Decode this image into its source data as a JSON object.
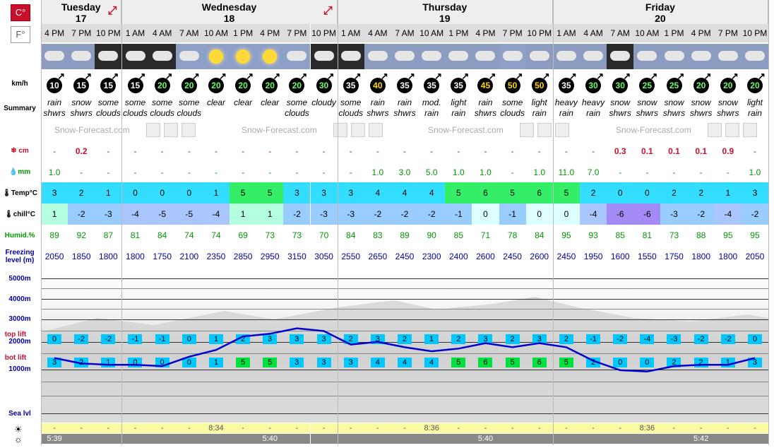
{
  "units": {
    "celsius": "C°",
    "fahrenheit": "F°"
  },
  "labels": {
    "wind": "km/h",
    "summary": "Summary",
    "snow": "cm",
    "rain": "mm",
    "temp": "Temp°C",
    "chill": "chill°C",
    "humidity": "Humid.%",
    "freezing": "Freezing level (m)",
    "alt5000": "5000m",
    "alt4000": "4000m",
    "alt3000": "3000m",
    "alt2000": "2000m",
    "alt1000": "1000m",
    "sea": "Sea lvl",
    "top_lift": "top lift",
    "bot_lift": "bot lift",
    "watermark": "Snow-Forecast.com"
  },
  "days": [
    {
      "name": "Tuesday",
      "date": "17",
      "cols": 3
    },
    {
      "name": "Wednesday",
      "date": "18",
      "cols": 8
    },
    {
      "name": "Thursday",
      "date": "19",
      "cols": 8
    },
    {
      "name": "Friday",
      "date": "20",
      "cols": 8
    }
  ],
  "hours": [
    "4 PM",
    "7 PM",
    "10 PM",
    "1 AM",
    "4 AM",
    "7 AM",
    "10 AM",
    "1 PM",
    "4 PM",
    "7 PM",
    "10 PM",
    "1 AM",
    "4 AM",
    "7 AM",
    "10 AM",
    "1 PM",
    "4 PM",
    "7 PM",
    "10 PM",
    "1 AM",
    "4 AM",
    "7 AM",
    "10 AM",
    "1 PM",
    "4 PM",
    "7 PM",
    "10 PM"
  ],
  "icons": [
    "rain-cloud-icon",
    "snow-cloud-icon",
    "cloud-moon-icon",
    "cloud-moon-icon",
    "cloud-moon-icon",
    "cloud-sun-icon",
    "sun-icon",
    "sun-icon",
    "sun-icon",
    "cloud-sun-icon",
    "cloud-night-icon",
    "cloud-moon-icon",
    "rain-cloud-icon",
    "rain-cloud-icon",
    "rain-heavy-icon",
    "rain-heavy-icon",
    "rain-sun-icon",
    "cloud-sun-icon",
    "rain-heavy-icon",
    "rain-heavy-icon",
    "rain-heavy-icon",
    "snow-moon-icon",
    "snow-cloud-icon",
    "snow-cloud-icon",
    "snow-cloud-icon",
    "snow-cloud-icon",
    "rain-heavy-icon"
  ],
  "wind": [
    10,
    15,
    15,
    15,
    20,
    20,
    20,
    20,
    20,
    20,
    30,
    35,
    40,
    35,
    35,
    35,
    45,
    50,
    50,
    35,
    30,
    30,
    25,
    25,
    20,
    20,
    20
  ],
  "summary": [
    "rain shwrs",
    "snow shwrs",
    "some clouds",
    "some clouds",
    "some clouds",
    "some clouds",
    "clear",
    "clear",
    "clear",
    "some clouds",
    "cloudy",
    "some clouds",
    "rain shwrs",
    "rain shwrs",
    "mod. rain",
    "light rain",
    "rain shwrs",
    "some clouds",
    "light rain",
    "heavy rain",
    "heavy rain",
    "snow shwrs",
    "snow shwrs",
    "snow shwrs",
    "snow shwrs",
    "snow shwrs",
    "light rain"
  ],
  "snow": [
    "-",
    "0.2",
    "-",
    "-",
    "-",
    "-",
    "-",
    "-",
    "-",
    "-",
    "-",
    "-",
    "-",
    "-",
    "-",
    "-",
    "-",
    "-",
    "-",
    "-",
    "-",
    "0.3",
    "0.1",
    "0.1",
    "0.1",
    "0.9",
    "-"
  ],
  "rain": [
    "1.0",
    "-",
    "-",
    "-",
    "-",
    "-",
    "-",
    "-",
    "-",
    "-",
    "-",
    "-",
    "1.0",
    "3.0",
    "5.0",
    "1.0",
    "1.0",
    "-",
    "1.0",
    "11.0",
    "7.0",
    "-",
    "-",
    "-",
    "-",
    "-",
    "1.0"
  ],
  "temp": [
    3,
    2,
    1,
    0,
    0,
    0,
    1,
    5,
    5,
    3,
    3,
    3,
    4,
    4,
    4,
    5,
    6,
    5,
    6,
    5,
    2,
    0,
    0,
    2,
    2,
    1,
    3
  ],
  "chill": [
    1,
    -2,
    -3,
    -4,
    -5,
    -5,
    -4,
    1,
    1,
    -2,
    -3,
    -3,
    -2,
    -2,
    -2,
    -1,
    0,
    -1,
    0,
    0,
    -4,
    -6,
    -6,
    -3,
    -2,
    -4,
    -2
  ],
  "humidity": [
    89,
    92,
    87,
    81,
    84,
    74,
    74,
    69,
    73,
    73,
    70,
    84,
    83,
    89,
    90,
    85,
    71,
    78,
    84,
    95,
    93,
    85,
    81,
    73,
    88,
    95,
    95
  ],
  "freezing": [
    2050,
    1850,
    1800,
    1800,
    1750,
    2100,
    2350,
    2850,
    2950,
    3150,
    3050,
    2550,
    2650,
    2450,
    2300,
    2400,
    2600,
    2450,
    2600,
    2450,
    1950,
    1600,
    1550,
    1750,
    1800,
    1800,
    2050
  ],
  "top_lift": [
    0,
    -2,
    -2,
    -1,
    -1,
    0,
    1,
    2,
    3,
    3,
    3,
    2,
    3,
    2,
    1,
    2,
    3,
    2,
    3,
    2,
    -1,
    -2,
    -4,
    -3,
    -2,
    -2,
    0
  ],
  "bot_lift": [
    3,
    2,
    1,
    0,
    0,
    0,
    1,
    5,
    5,
    3,
    3,
    3,
    4,
    4,
    4,
    5,
    6,
    5,
    6,
    5,
    2,
    0,
    0,
    2,
    2,
    1,
    3
  ],
  "sun": {
    "sunrise": [
      "8:34",
      "8:36",
      "8:36"
    ],
    "sunset": [
      "5:39",
      "5:40",
      "5:40",
      "5:42"
    ],
    "dash": "-"
  }
}
